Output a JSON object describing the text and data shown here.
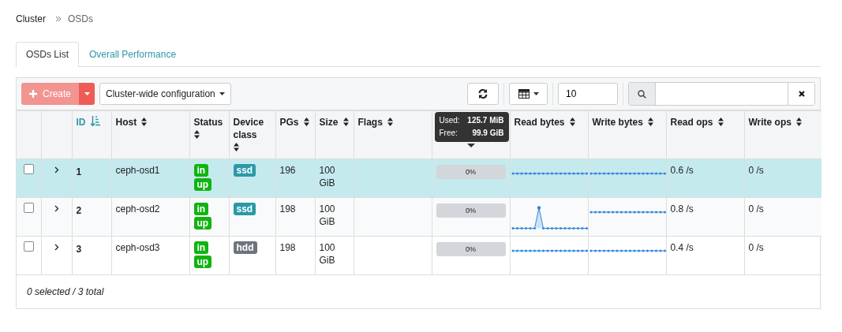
{
  "breadcrumb": [
    {
      "label": "Cluster",
      "current": false
    },
    {
      "label": "OSDs",
      "current": true
    }
  ],
  "tabs": [
    {
      "label": "OSDs List",
      "selected": true
    },
    {
      "label": "Overall Performance",
      "selected": false
    }
  ],
  "toolbar": {
    "create": {
      "label": "Create",
      "disabled": true
    },
    "config_dropdown": {
      "label": "Cluster-wide configuration"
    },
    "page_size": {
      "value": "10"
    }
  },
  "table": {
    "columns": [
      {
        "label": "ID",
        "sorted": true
      },
      {
        "label": "Host",
        "sorted": false
      },
      {
        "label": "Status",
        "sorted": false
      },
      {
        "label": "Device class",
        "sorted": false
      },
      {
        "label": "PGs",
        "sorted": false
      },
      {
        "label": "Size",
        "sorted": false
      },
      {
        "label": "Flags",
        "sorted": false
      },
      {
        "label": "Read bytes",
        "sorted": false
      },
      {
        "label": "Write bytes",
        "sorted": false
      },
      {
        "label": "Read ops",
        "sorted": false
      },
      {
        "label": "Write ops",
        "sorted": false
      }
    ],
    "usage_tooltip": {
      "used_label": "Used:",
      "used_value": "125.7 MiB",
      "free_label": "Free:",
      "free_value": "99.9 GiB"
    },
    "rows": [
      {
        "selected": true,
        "checked": false,
        "id": "1",
        "host": "ceph-osd1",
        "status": [
          "in",
          "up"
        ],
        "device_class": {
          "label": "ssd",
          "color": "#2b99a8"
        },
        "pgs": "196",
        "size": "100 GiB",
        "usage": {
          "level": 0,
          "reading": "0%"
        },
        "sparklines": [
          {
            "kind": "flat"
          },
          {
            "kind": "flat"
          }
        ],
        "read_ops": "0.6 /s",
        "write_ops": "0 /s"
      },
      {
        "selected": false,
        "checked": false,
        "id": "2",
        "host": "ceph-osd2",
        "status": [
          "in",
          "up"
        ],
        "device_class": {
          "label": "ssd",
          "color": "#2b99a8"
        },
        "pgs": "198",
        "size": "100 GiB",
        "usage": {
          "level": 0,
          "reading": "0%"
        },
        "sparklines": [
          {
            "kind": "spike"
          },
          {
            "kind": "flat"
          }
        ],
        "read_ops": "0.8 /s",
        "write_ops": "0 /s"
      },
      {
        "selected": false,
        "checked": false,
        "id": "3",
        "host": "ceph-osd3",
        "status": [
          "in",
          "up"
        ],
        "device_class": {
          "label": "hdd",
          "color": "#6c757d"
        },
        "pgs": "198",
        "size": "100 GiB",
        "usage": {
          "level": 0,
          "reading": "0%"
        },
        "sparklines": [
          {
            "kind": "flat"
          },
          {
            "kind": "flat"
          }
        ],
        "read_ops": "0.4 /s",
        "write_ops": "0 /s"
      }
    ],
    "footer": "0 selected / 3 total"
  }
}
